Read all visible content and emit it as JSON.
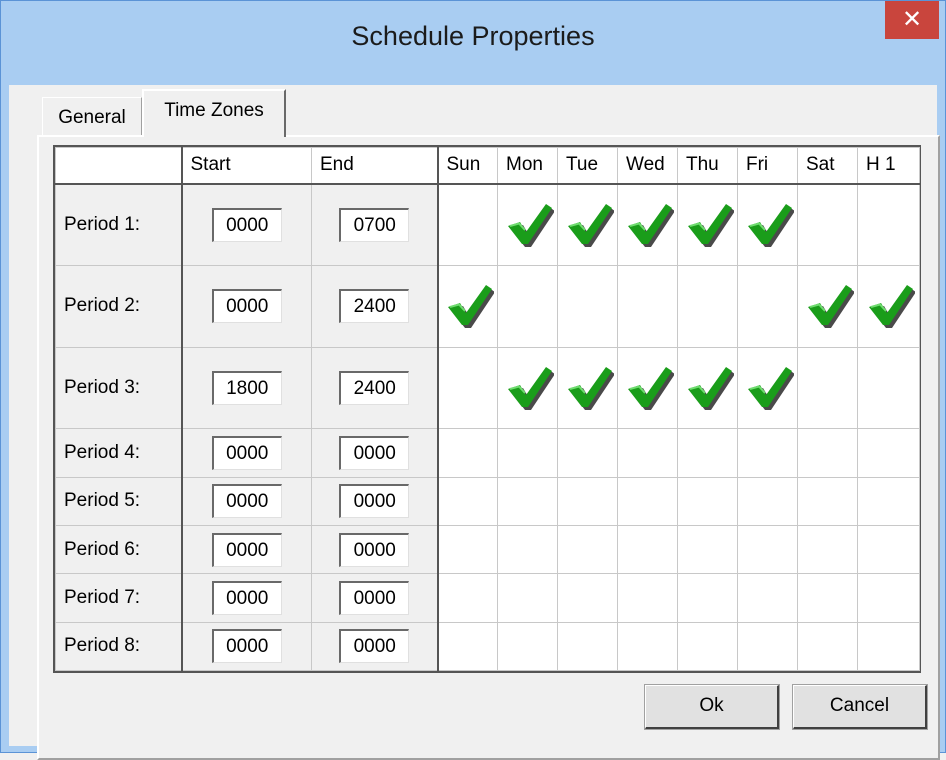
{
  "window": {
    "title": "Schedule Properties",
    "close_glyph": "✕"
  },
  "tabs": [
    {
      "label": "General",
      "active": false
    },
    {
      "label": "Time Zones",
      "active": true
    }
  ],
  "grid": {
    "headers": {
      "start": "Start",
      "end": "End",
      "days": [
        "Sun",
        "Mon",
        "Tue",
        "Wed",
        "Thu",
        "Fri",
        "Sat",
        "H 1"
      ]
    },
    "periods": [
      {
        "label": "Period 1:",
        "start": "0000",
        "end": "0700",
        "checked": [
          false,
          true,
          true,
          true,
          true,
          true,
          false,
          false
        ]
      },
      {
        "label": "Period 2:",
        "start": "0000",
        "end": "2400",
        "checked": [
          true,
          false,
          false,
          false,
          false,
          false,
          true,
          true
        ]
      },
      {
        "label": "Period 3:",
        "start": "1800",
        "end": "2400",
        "checked": [
          false,
          true,
          true,
          true,
          true,
          true,
          false,
          false
        ]
      },
      {
        "label": "Period 4:",
        "start": "0000",
        "end": "0000",
        "checked": [
          false,
          false,
          false,
          false,
          false,
          false,
          false,
          false
        ]
      },
      {
        "label": "Period 5:",
        "start": "0000",
        "end": "0000",
        "checked": [
          false,
          false,
          false,
          false,
          false,
          false,
          false,
          false
        ]
      },
      {
        "label": "Period 6:",
        "start": "0000",
        "end": "0000",
        "checked": [
          false,
          false,
          false,
          false,
          false,
          false,
          false,
          false
        ]
      },
      {
        "label": "Period 7:",
        "start": "0000",
        "end": "0000",
        "checked": [
          false,
          false,
          false,
          false,
          false,
          false,
          false,
          false
        ]
      },
      {
        "label": "Period 8:",
        "start": "0000",
        "end": "0000",
        "checked": [
          false,
          false,
          false,
          false,
          false,
          false,
          false,
          false
        ]
      }
    ]
  },
  "buttons": {
    "ok": "Ok",
    "cancel": "Cancel"
  },
  "colors": {
    "check_green": "#1a9d1a",
    "check_shadow": "#4a4a4a",
    "close_red": "#c9453d",
    "titlebar": "#a9cdf2"
  },
  "icons": {
    "check": "checkmark-icon",
    "close": "close-icon"
  }
}
